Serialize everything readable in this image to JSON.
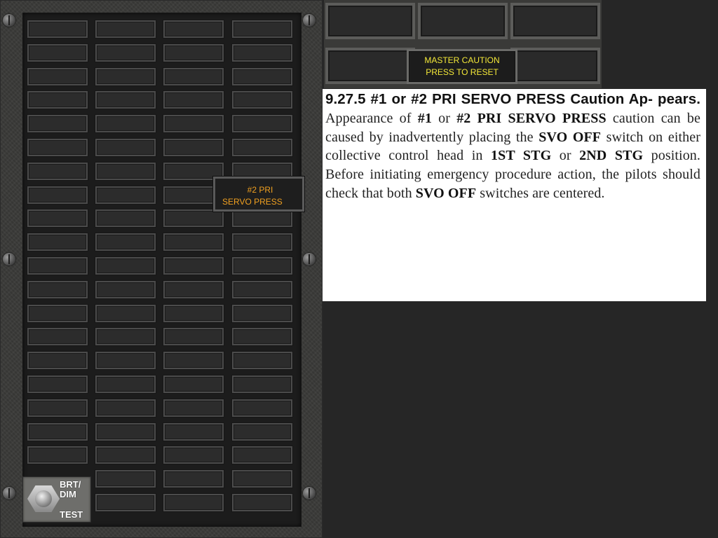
{
  "caution_panel": {
    "lit_annunciator": {
      "line1": "#2 PRI",
      "line2": "SERVO PRESS",
      "color": "#f0a020"
    },
    "brt_dim_label": "BRT/ DIM",
    "brt_dim_line1": "BRT/",
    "brt_dim_line2": "DIM",
    "test_label": "TEST"
  },
  "master_caution": {
    "line1": "MASTER CAUTION",
    "line2": "PRESS TO RESET",
    "color": "#f3e838"
  },
  "procedure": {
    "heading": "9.27.5  #1 or #2 PRI SERVO PRESS Caution Appears.",
    "heading_part1": "9.27.5  #1 or #2 PRI SERVO PRESS Caution Ap-",
    "heading_part2": "pears.",
    "body_segments": [
      {
        "text": " Appearance of ",
        "bold": false
      },
      {
        "text": "#1",
        "bold": true
      },
      {
        "text": " or ",
        "bold": false
      },
      {
        "text": "#2 PRI SERVO PRESS",
        "bold": true
      },
      {
        "text": " caution can be caused by inadvertently placing the ",
        "bold": false
      },
      {
        "text": "SVO OFF",
        "bold": true
      },
      {
        "text": " switch on either collective control head in ",
        "bold": false
      },
      {
        "text": "1ST STG",
        "bold": true
      },
      {
        "text": " or ",
        "bold": false
      },
      {
        "text": "2ND STG",
        "bold": true
      },
      {
        "text": " position. Before initiating emergency procedure action, the pilots should check that both ",
        "bold": false
      },
      {
        "text": "SVO OFF",
        "bold": true
      },
      {
        "text": " switches are centered.",
        "bold": false
      }
    ]
  }
}
